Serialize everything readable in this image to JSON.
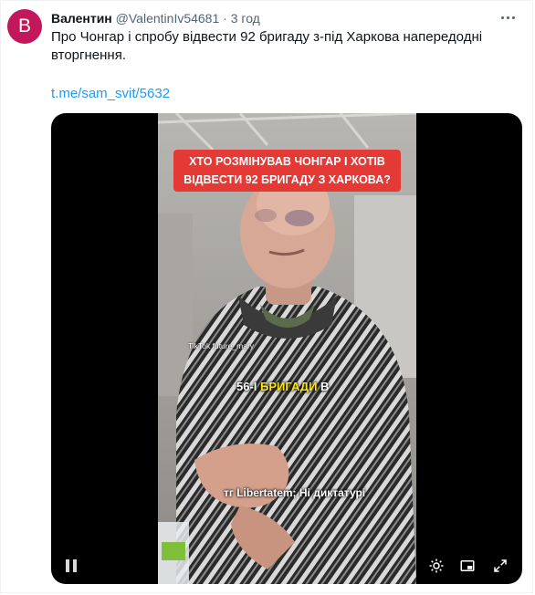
{
  "tweet": {
    "avatar_letter": "B",
    "display_name": "Валентин",
    "handle": "@ValentinIv54681",
    "separator": "·",
    "time": "3 год",
    "text": "Про Чонгар і спробу відвести 92 бригаду з-під Харкова напередодні вторгнення.",
    "link": "t.me/sam_svit/5632",
    "avatar_color": "#c2185b",
    "link_color": "#1d9bf0"
  },
  "video": {
    "banner_line1": "ХТО РОЗМІНУВАВ ЧОНГАР І ХОТІВ",
    "banner_line2": "ВІДВЕСТИ 92 БРИГАДУ З ХАРКОВА?",
    "watermark": "TikTok future_mary",
    "subtitle_prefix": "56-І",
    "subtitle_highlight": "БРИГАДИ",
    "subtitle_suffix": "В",
    "bottom_caption": "тг Libertatem; Ні диктатурі",
    "banner_color": "#e53935",
    "highlight_color": "#ffe500"
  },
  "controls": {
    "pause": "pause-icon",
    "settings": "settings-icon",
    "pip": "picture-in-picture-icon",
    "fullscreen": "fullscreen-icon"
  }
}
